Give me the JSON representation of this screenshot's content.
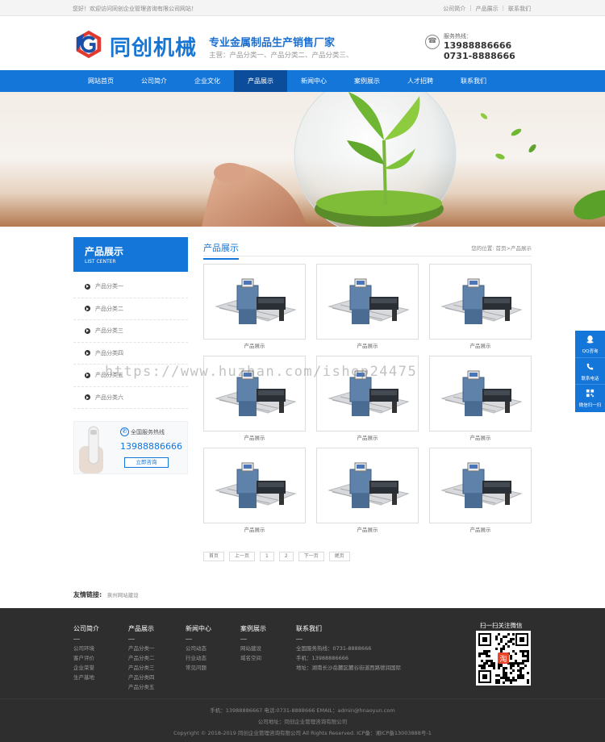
{
  "topbar": {
    "welcome": "您好！欢迎访问同创企业管理咨询有限公司网站！",
    "links": [
      "公司简介",
      "产品展示",
      "联系我们"
    ]
  },
  "header": {
    "logo_text": "同创机械",
    "slogan": "专业金属制品生产销售厂家",
    "sub_slogan": "主营：产品分类一、产品分类二、产品分类三、",
    "hotline_label": "服务热线：",
    "hotline_1": "13988886666",
    "hotline_2": "0731-8888666"
  },
  "nav": {
    "items": [
      "网站首页",
      "公司简介",
      "企业文化",
      "产品展示",
      "新闻中心",
      "案例展示",
      "人才招聘",
      "联系我们"
    ],
    "active_index": 3
  },
  "sidebar": {
    "title": "产品展示",
    "subtitle": "LIST CENTER",
    "items": [
      "产品分类一",
      "产品分类二",
      "产品分类三",
      "产品分类四",
      "产品分类五",
      "产品分类六"
    ],
    "contact": {
      "label": "全国服务热线",
      "phone": "13988886666",
      "button": "立即咨询"
    }
  },
  "main": {
    "title": "产品展示",
    "breadcrumb": "您的位置: 首页>产品展示",
    "products": [
      "产品展示",
      "产品展示",
      "产品展示",
      "产品展示",
      "产品展示",
      "产品展示",
      "产品展示",
      "产品展示",
      "产品展示"
    ],
    "pager": [
      "首页",
      "上一页",
      "1",
      "2",
      "下一页",
      "尾页"
    ]
  },
  "friend_links": {
    "label": "友情链接:",
    "links": [
      "泉州网站建设"
    ]
  },
  "footer": {
    "columns": [
      {
        "title": "公司简介",
        "links": [
          "公司环境",
          "客户评价",
          "企业荣誉",
          "生产基地"
        ]
      },
      {
        "title": "产品展示",
        "links": [
          "产品分类一",
          "产品分类二",
          "产品分类三",
          "产品分类四",
          "产品分类五"
        ]
      },
      {
        "title": "新闻中心",
        "links": [
          "公司动态",
          "行业动态",
          "常见问题"
        ]
      },
      {
        "title": "案例展示",
        "links": [
          "网站建设",
          "域名空间"
        ]
      },
      {
        "title": "联系我们",
        "links": [
          "全国服务热线：0731-8888666",
          "手机：13988886666",
          "地址：湖南长沙岳麓区麓谷街道西路德润国际"
        ]
      }
    ],
    "qr_title": "扫一扫关注微信",
    "line_1": "手机：13988886667 电话:0731-8888666 EMAIL：admin@hnaoyun.com",
    "line_2": "公司地址：同创企业管理咨询有限公司",
    "line_3": "Copyright © 2018-2019 同创企业管理咨询有限公司 All Rights Reserved. ICP备：湘ICP备13003888号-1"
  },
  "float_bar": [
    "QQ咨询",
    "联系电话",
    "微信扫一扫"
  ],
  "watermark": "https://www.huzhan.com/ishop24475",
  "colors": {
    "primary": "#1476d9",
    "nav_active": "#0b4d9a",
    "footer_bg": "#2e2e2e"
  }
}
